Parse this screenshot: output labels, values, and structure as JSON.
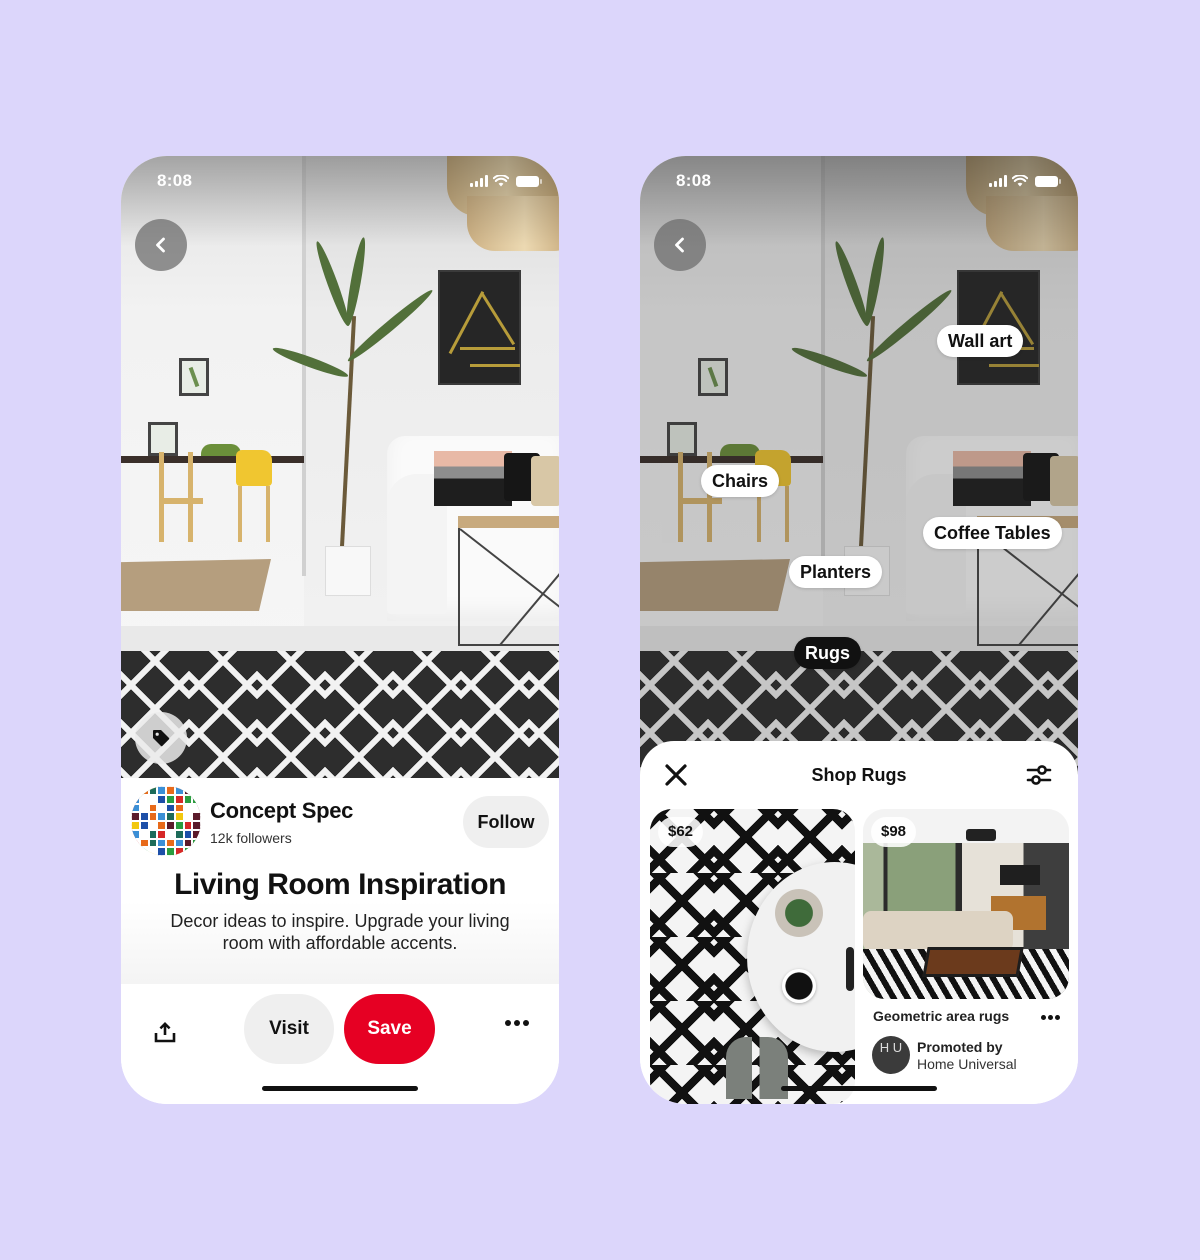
{
  "colors": {
    "background": "#dcd6fb",
    "save_button": "#e60023",
    "secondary_button": "#efefef",
    "text_primary": "#111111",
    "active_tag": "#111111"
  },
  "left_screen": {
    "status_bar": {
      "time": "8:08",
      "icons": [
        "signal-icon",
        "wifi-icon",
        "battery-icon"
      ]
    },
    "back_button": {
      "icon": "chevron-left-icon"
    },
    "shop_tag_button": {
      "icon": "tag-icon"
    },
    "creator": {
      "name": "Concept Spec",
      "followers": "12k followers",
      "follow_label": "Follow"
    },
    "pin": {
      "title": "Living Room Inspiration",
      "description": "Decor ideas to inspire. Upgrade your living room with affordable accents."
    },
    "actions": {
      "share_icon": "share-icon",
      "visit_label": "Visit",
      "save_label": "Save",
      "more_icon": "ellipsis-icon"
    }
  },
  "right_screen": {
    "status_bar": {
      "time": "8:08",
      "icons": [
        "signal-icon",
        "wifi-icon",
        "battery-icon"
      ]
    },
    "back_button": {
      "icon": "chevron-left-icon"
    },
    "object_tags": [
      {
        "label": "Wall art",
        "active": false
      },
      {
        "label": "Chairs",
        "active": false
      },
      {
        "label": "Coffee Tables",
        "active": false
      },
      {
        "label": "Planters",
        "active": false
      },
      {
        "label": "Rugs",
        "active": true
      }
    ],
    "shop_sheet": {
      "title": "Shop Rugs",
      "close_icon": "close-icon",
      "filter_icon": "filter-sliders-icon",
      "products": [
        {
          "price": "$62"
        },
        {
          "price": "$98",
          "title": "Geometric area rugs",
          "promoted_label": "Promoted by",
          "promoter": "Home Universal",
          "promoter_logo": "H U"
        }
      ]
    }
  }
}
